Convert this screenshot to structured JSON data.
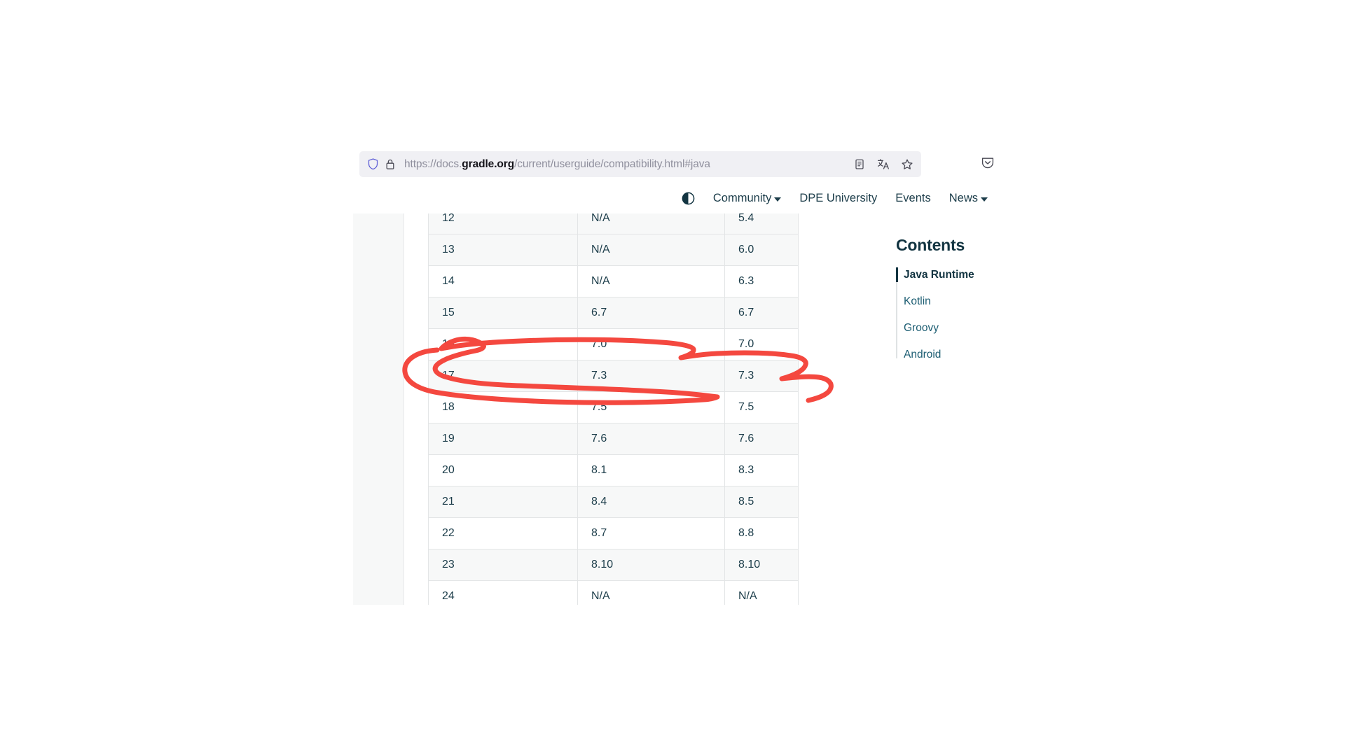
{
  "browser": {
    "url": {
      "scheme": "https://docs.",
      "domain": "gradle.org",
      "path": "/current/userguide/compatibility.html#java",
      "full": "https://docs.gradle.org/current/userguide/compatibility.html#java"
    },
    "icons": {
      "shield": "shield-icon",
      "lock": "lock-icon",
      "reader": "reader-view-icon",
      "translate": "translate-icon",
      "bookmark": "bookmark-star-icon",
      "pocket": "pocket-save-icon"
    }
  },
  "sitenav": {
    "theme_toggle": "dark-mode-toggle-icon",
    "items": [
      {
        "label": "Community",
        "has_caret": true
      },
      {
        "label": "DPE University",
        "has_caret": false
      },
      {
        "label": "Events",
        "has_caret": false
      },
      {
        "label": "News",
        "has_caret": true
      }
    ]
  },
  "table": {
    "rows": [
      {
        "java": "12",
        "kotlin": "N/A",
        "groovy": "5.4",
        "stripe": "odd",
        "clipped_top": true
      },
      {
        "java": "13",
        "kotlin": "N/A",
        "groovy": "6.0",
        "stripe": "odd"
      },
      {
        "java": "14",
        "kotlin": "N/A",
        "groovy": "6.3",
        "stripe": "even"
      },
      {
        "java": "15",
        "kotlin": "6.7",
        "groovy": "6.7",
        "stripe": "odd"
      },
      {
        "java": "16",
        "kotlin": "7.0",
        "groovy": "7.0",
        "stripe": "even"
      },
      {
        "java": "17",
        "kotlin": "7.3",
        "groovy": "7.3",
        "stripe": "odd",
        "highlighted": true
      },
      {
        "java": "18",
        "kotlin": "7.5",
        "groovy": "7.5",
        "stripe": "even"
      },
      {
        "java": "19",
        "kotlin": "7.6",
        "groovy": "7.6",
        "stripe": "odd"
      },
      {
        "java": "20",
        "kotlin": "8.1",
        "groovy": "8.3",
        "stripe": "even"
      },
      {
        "java": "21",
        "kotlin": "8.4",
        "groovy": "8.5",
        "stripe": "odd"
      },
      {
        "java": "22",
        "kotlin": "8.7",
        "groovy": "8.8",
        "stripe": "even"
      },
      {
        "java": "23",
        "kotlin": "8.10",
        "groovy": "8.10",
        "stripe": "odd"
      },
      {
        "java": "24",
        "kotlin": "N/A",
        "groovy": "N/A",
        "stripe": "even",
        "clipped_bottom": true
      }
    ]
  },
  "contents": {
    "title": "Contents",
    "items": [
      {
        "label": "Java Runtime",
        "active": true
      },
      {
        "label": "Kotlin",
        "active": false
      },
      {
        "label": "Groovy",
        "active": false
      },
      {
        "label": "Android",
        "active": false
      }
    ]
  },
  "annotation": {
    "type": "hand-drawn-ellipse",
    "color": "#f4483f",
    "target_row": "17",
    "stroke_width": 7
  }
}
